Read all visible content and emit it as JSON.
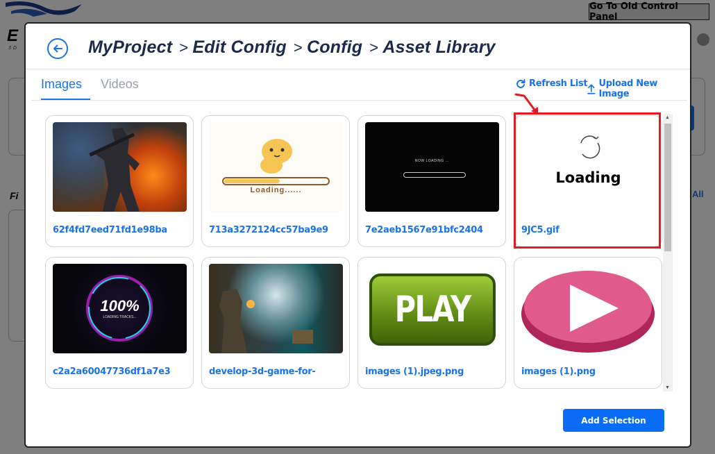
{
  "background": {
    "old_panel_label": "Go To Old Control Panel",
    "logo_letter": "E",
    "logo_sub": "3D",
    "side_letter": "Fi",
    "right_link": "All"
  },
  "modal": {
    "breadcrumb": [
      "MyProject",
      "Edit Config",
      "Config",
      "Asset Library"
    ],
    "breadcrumb_separator": ">",
    "tabs": [
      {
        "label": "Images",
        "active": true
      },
      {
        "label": "Videos",
        "active": false
      }
    ],
    "actions": {
      "refresh": "Refresh List",
      "upload": "Upload New Image"
    },
    "items": [
      {
        "label": "62f4fd7eed71fd1e98ba",
        "thumb": "soldier-fire-image"
      },
      {
        "label": "713a3272124cc57ba9e9",
        "thumb": "hamster-loading-image",
        "thumb_text": "Loading......"
      },
      {
        "label": "7e2aeb1567e91bfc2404",
        "thumb": "now-loading-image",
        "thumb_text": "NOW LOADING ..."
      },
      {
        "label": "9JC5.gif",
        "thumb": "spinner-loading",
        "thumb_text": "Loading",
        "highlighted": true
      },
      {
        "label": "c2a2a60047736df1a7e3",
        "thumb": "loading-ring-image",
        "thumb_text": "100%",
        "thumb_subtext": "LOADING TRACKS..."
      },
      {
        "label": "develop-3d-game-for-",
        "thumb": "soldiers-street-image"
      },
      {
        "label": "images (1).jpeg.png",
        "thumb": "play-button-image",
        "thumb_text": "PLAY"
      },
      {
        "label": "images (1).png",
        "thumb": "pink-play-image"
      }
    ],
    "add_selection": "Add Selection"
  },
  "colors": {
    "accent": "#1a73e8",
    "highlight": "#e21b22",
    "primary_button": "#0a6cf5"
  }
}
